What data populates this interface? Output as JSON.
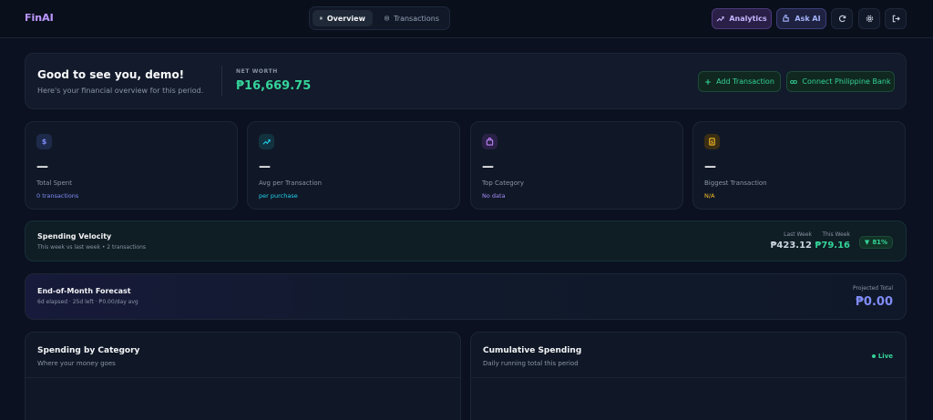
{
  "app": {
    "logo": "FinAI"
  },
  "nav": {
    "tabs": [
      {
        "label": "Overview",
        "icon": "grid-icon",
        "active": true
      },
      {
        "label": "Transactions",
        "icon": "document-icon",
        "active": false
      }
    ],
    "analytics_label": "Analytics",
    "ask_ai_label": "Ask AI",
    "icons": [
      "trend-icon",
      "sparkle-icon",
      "refresh-icon",
      "gear-icon",
      "logout-icon"
    ]
  },
  "hero": {
    "greeting": "Good to see you, demo!",
    "subtitle": "Here's your financial overview for this period.",
    "net_worth_label": "NET WORTH",
    "net_worth_value": "₱16,669.75",
    "add_transaction_label": "Add Transaction",
    "connect_bank_label": "Connect Philippine Bank"
  },
  "stats": [
    {
      "icon": "dollar-icon",
      "value": "—",
      "label": "Total Spent",
      "sub": "0 transactions",
      "color": "#818cf8"
    },
    {
      "icon": "trend-up-icon",
      "value": "—",
      "label": "Avg per Transaction",
      "sub": "per purchase",
      "color": "#22d3ee"
    },
    {
      "icon": "bag-icon",
      "value": "—",
      "label": "Top Category",
      "sub": "No data",
      "color": "#a78bfa"
    },
    {
      "icon": "receipt-icon",
      "value": "—",
      "label": "Biggest Transaction",
      "sub": "N/A",
      "color": "#fbbf24"
    }
  ],
  "velocity": {
    "title": "Spending Velocity",
    "subtitle": "This week vs last week • 2 transactions",
    "last_week_label": "Last Week",
    "last_week_value": "₱423.12",
    "this_week_label": "This Week",
    "this_week_value": "₱79.16",
    "change": "81%"
  },
  "forecast": {
    "title": "End-of-Month Forecast",
    "subtitle": "6d elapsed · 25d left · ₱0.00/day avg",
    "projected_label": "Projected Total",
    "projected_value": "₱0.00"
  },
  "panels": {
    "category_title": "Spending by Category",
    "category_sub": "Where your money goes",
    "cumulative_title": "Cumulative Spending",
    "cumulative_sub": "Daily running total this period",
    "live_label": "Live"
  },
  "colors": {
    "accent_green": "#34d399",
    "accent_purple": "#a78bfa",
    "accent_indigo": "#818cf8",
    "background": "#0b1120"
  }
}
